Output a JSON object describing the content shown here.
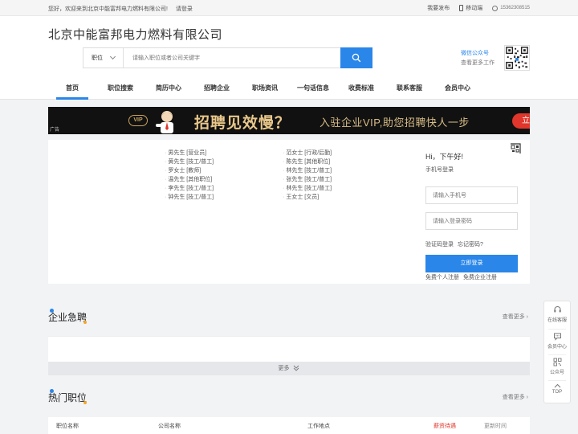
{
  "topbar": {
    "welcome": "您好，欢迎来到北京中能富邦电力燃料有限公司!",
    "login": "请登录",
    "post": "我要发布",
    "mobile": "移动端",
    "phone": "15362308515"
  },
  "header": {
    "site_title": "北京中能富邦电力燃料有限公司",
    "search_type": "职位",
    "search_placeholder": "请输入职位或者公司关键字",
    "wechat_title": "微信公众号",
    "wechat_sub": "查看更多工作"
  },
  "nav": {
    "items": [
      "首页",
      "职位搜索",
      "简历中心",
      "招聘企业",
      "职场资讯",
      "一句话信息",
      "收费标准",
      "联系客服",
      "会员中心"
    ]
  },
  "banner": {
    "tag": "广告",
    "vip": "VIP",
    "headline": "招聘见效慢？",
    "sub": "入驻企业VIP,助您招聘快人一步",
    "cta": "立即查看"
  },
  "names_col1": [
    "男先生 [营业员]",
    "黄先生 [技工/普工]",
    "罗女士 [教师]",
    "温先生 [其他职位]",
    "李先生 [技工/普工]",
    "钟先生 [技工/普工]"
  ],
  "names_col2": [
    "范女士 [行政/后勤]",
    "陈先生 [其他职位]",
    "林先生 [技工/普工]",
    "张先生 [技工/普工]",
    "林先生 [技工/普工]",
    "王女士 [文员]"
  ],
  "login": {
    "greeting": "Hi，下午好!",
    "mode_label": "手机号登录",
    "phone_placeholder": "请输入手机号",
    "password_placeholder": "请输入登录密码",
    "code_login": "验证码登录",
    "forgot": "忘记密码?",
    "submit": "立即登录",
    "reg_personal": "免费个人注册",
    "reg_company": "免费企业注册"
  },
  "sections": {
    "urgent_title": "企业急聘",
    "hot_title": "热门职位",
    "more": "查看更多 ›",
    "more_bar": "更多"
  },
  "table": {
    "headers": [
      "职位名称",
      "公司名称",
      "工作地点",
      "薪资待遇",
      "更新时间"
    ]
  },
  "sidebar": {
    "items": [
      "在线客服",
      "会员中心",
      "公众号",
      "TOP"
    ]
  }
}
